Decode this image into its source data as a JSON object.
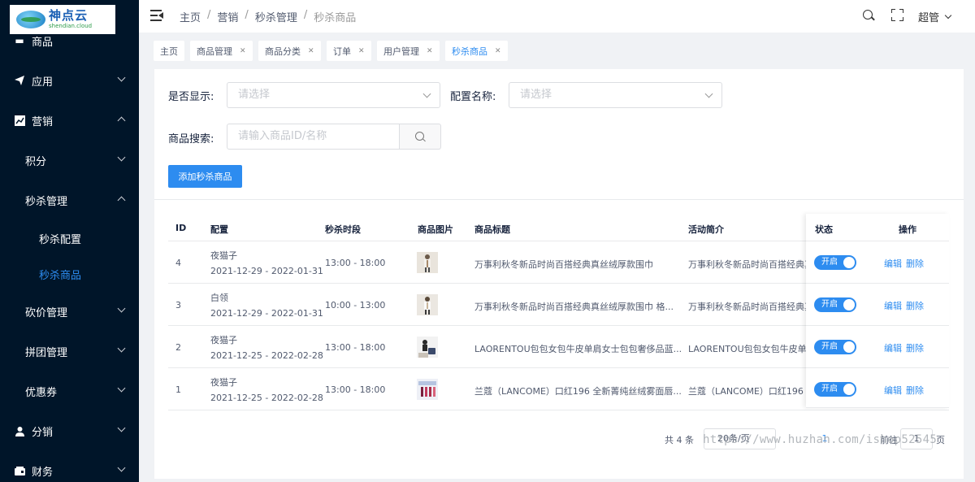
{
  "logo": {
    "cn": "神点云",
    "en": "shendian.cloud"
  },
  "sidebar": {
    "items": [
      {
        "label": "商品",
        "level": 1,
        "icon": "goods-icon",
        "chevron": "none"
      },
      {
        "label": "应用",
        "level": 1,
        "icon": "send-icon",
        "chevron": "down"
      },
      {
        "label": "营销",
        "level": 1,
        "icon": "trend-icon",
        "chevron": "up"
      },
      {
        "label": "积分",
        "level": 2,
        "chevron": "down"
      },
      {
        "label": "秒杀管理",
        "level": 2,
        "chevron": "up"
      },
      {
        "label": "秒杀配置",
        "level": 3,
        "chevron": "none"
      },
      {
        "label": "秒杀商品",
        "level": 3,
        "chevron": "none",
        "active": true
      },
      {
        "label": "砍价管理",
        "level": 2,
        "chevron": "down"
      },
      {
        "label": "拼团管理",
        "level": 2,
        "chevron": "down"
      },
      {
        "label": "优惠券",
        "level": 2,
        "chevron": "down"
      },
      {
        "label": "分销",
        "level": 1,
        "icon": "user-icon",
        "chevron": "down"
      },
      {
        "label": "财务",
        "level": 1,
        "icon": "wallet-icon",
        "chevron": "down"
      }
    ]
  },
  "header": {
    "breadcrumb": [
      "主页",
      "营销",
      "秒杀管理",
      "秒杀商品"
    ],
    "user": "超管"
  },
  "tabs": [
    {
      "label": "主页",
      "closable": false
    },
    {
      "label": "商品管理",
      "closable": true
    },
    {
      "label": "商品分类",
      "closable": true
    },
    {
      "label": "订单",
      "closable": true
    },
    {
      "label": "用户管理",
      "closable": true
    },
    {
      "label": "秒杀商品",
      "closable": true,
      "active": true
    }
  ],
  "filters": {
    "show_label": "是否显示:",
    "show_placeholder": "请选择",
    "config_label": "配置名称:",
    "config_placeholder": "请选择",
    "search_label": "商品搜索:",
    "search_placeholder": "请输入商品ID/名称",
    "add_button": "添加秒杀商品"
  },
  "table": {
    "columns": [
      "ID",
      "配置",
      "秒杀时段",
      "商品图片",
      "商品标题",
      "活动简介",
      "状态",
      "操作"
    ],
    "rows": [
      {
        "id": "4",
        "config_name": "夜猫子",
        "config_dates": "2021-12-29 - 2022-01-31",
        "time": "13:00 - 18:00",
        "title": "万事利秋冬新品时尚百搭经典真丝绒厚款围巾",
        "intro": "万事利秋冬新品时尚百搭经典真",
        "status": "开启"
      },
      {
        "id": "3",
        "config_name": "白领",
        "config_dates": "2021-12-29 - 2022-01-31",
        "time": "10:00 - 13:00",
        "title": "万事利秋冬新品时尚百搭经典真丝绒厚款围巾 格...",
        "intro": "万事利秋冬新品时尚百搭经典真",
        "status": "开启"
      },
      {
        "id": "2",
        "config_name": "夜猫子",
        "config_dates": "2021-12-25 - 2022-02-28",
        "time": "13:00 - 18:00",
        "title": "LAORENTOU包包女包牛皮单肩女士包包奢侈品蓝...",
        "intro": "LAORENTOU包包女包牛皮单肩",
        "status": "开启"
      },
      {
        "id": "1",
        "config_name": "夜猫子",
        "config_dates": "2021-12-25 - 2022-02-28",
        "time": "13:00 - 18:00",
        "title": "兰蔻（LANCOME）口红196 全新菁纯丝绒雾面唇...",
        "intro": "兰蔻（LANCOME）口红196 全",
        "status": "开启"
      }
    ],
    "op_edit": "编辑",
    "op_delete": "删除"
  },
  "pagination": {
    "total": "共 4 条",
    "page_size": "20条/页",
    "current": "1",
    "jump_label": "前往",
    "jump_value": "1",
    "page_suffix": "页"
  },
  "watermark": "https://www.huzhan.com/ishop52545"
}
